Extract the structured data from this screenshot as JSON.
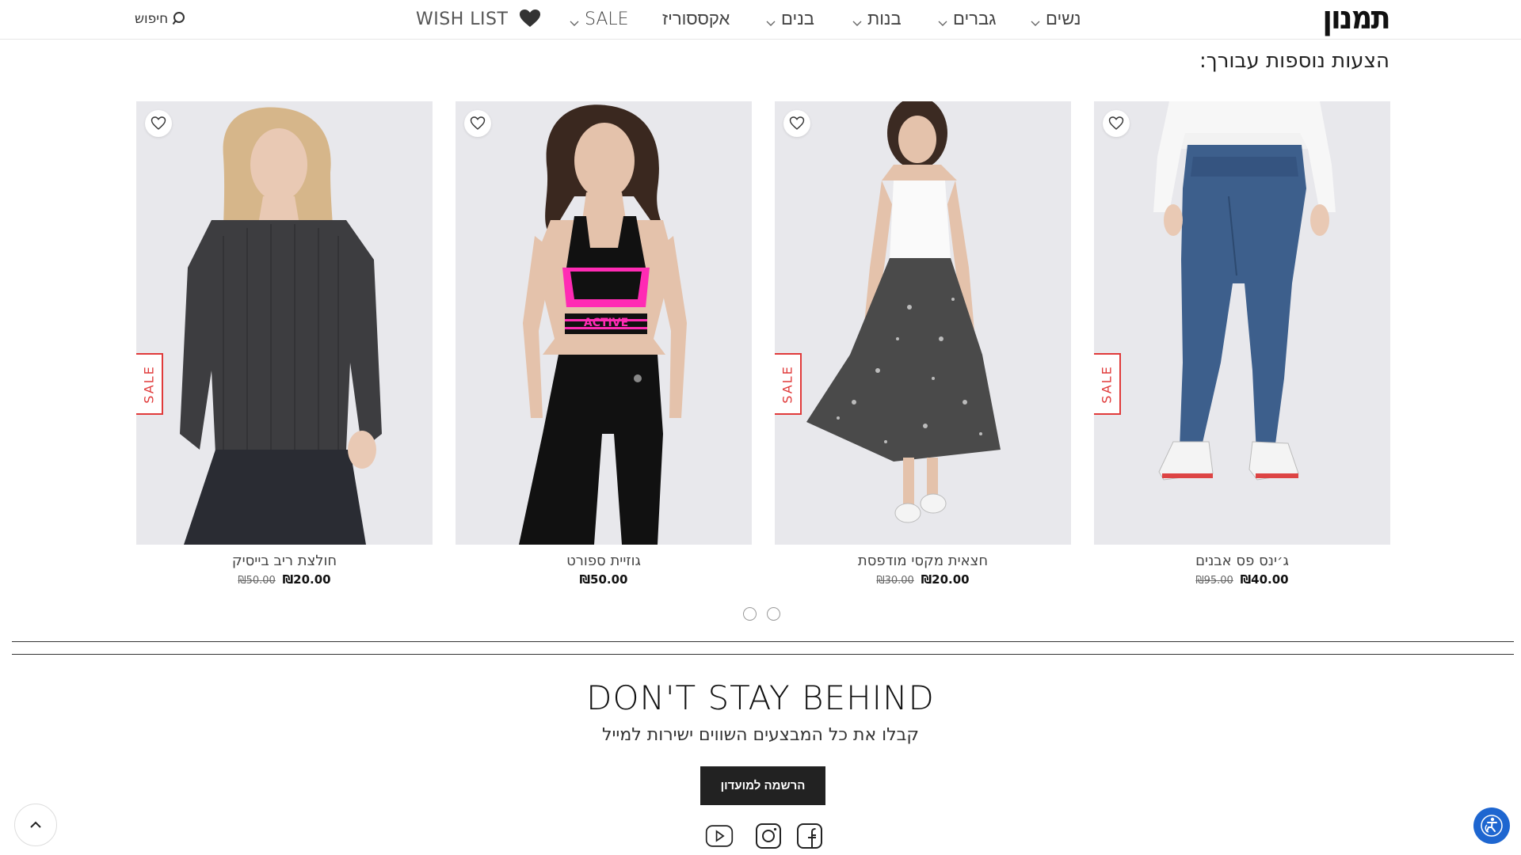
{
  "header": {
    "logo": "תמנון",
    "nav": [
      {
        "label": "נשים",
        "has_dropdown": true
      },
      {
        "label": "גברים",
        "has_dropdown": true
      },
      {
        "label": "בנות",
        "has_dropdown": true
      },
      {
        "label": "בנים",
        "has_dropdown": true
      },
      {
        "label": "אקססוריז",
        "has_dropdown": false
      },
      {
        "label": "SALE",
        "has_dropdown": true
      }
    ],
    "wishlist_label": "WISH LIST",
    "search_label": "חיפוש"
  },
  "section": {
    "title": "הצעות נוספות עבורך:"
  },
  "products": [
    {
      "name": "ג׳ינס פס אבנים",
      "price": "₪40.00",
      "old_price": "₪95.00",
      "sale_badge": "SALE"
    },
    {
      "name": "חצאית מקסי מודפסת",
      "price": "₪20.00",
      "old_price": "₪30.00",
      "sale_badge": "SALE"
    },
    {
      "name": "גוזיית ספורט",
      "price": "₪50.00",
      "old_price": "",
      "sale_badge": "",
      "print": "ACTIVE"
    },
    {
      "name": "חולצת ריב בייסיק",
      "price": "₪20.00",
      "old_price": "₪50.00",
      "sale_badge": "SALE"
    }
  ],
  "carousel": {
    "pages": 2,
    "current": 1
  },
  "newsletter": {
    "title": "DON'T STAY BEHIND",
    "subtitle": "קבלו את כל המבצעים השווים ישירות למייל",
    "button_label": "הרשמה למועדון"
  },
  "social": [
    "facebook-icon",
    "instagram-icon",
    "youtube-icon"
  ],
  "colors": {
    "sale_red": "#e03a3a",
    "button_dark": "#222222",
    "accessibility_blue": "#1e66d0",
    "sport_pink": "#ff2bb4"
  }
}
